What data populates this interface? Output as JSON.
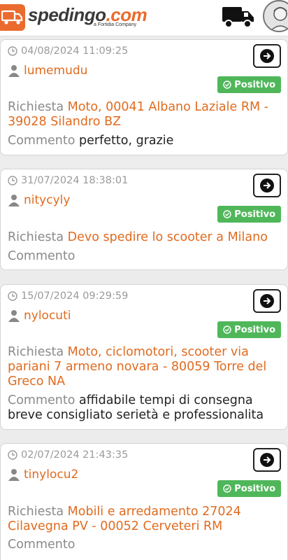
{
  "header": {
    "logo_name": "spedingo",
    "logo_dot": ".",
    "logo_tld": "com",
    "logo_sub": "a Fortidia Company",
    "truck_icon": "truck-icon",
    "avatar_icon": "avatar-icon"
  },
  "colors": {
    "accent": "#e06b1f",
    "positive": "#4fb75a"
  },
  "reviews": [
    {
      "date": "04/08/2024 11:09:25",
      "user": "lumemudu",
      "badge": "Positivo",
      "request_label": "Richiesta",
      "request": "Moto, 00041 Albano Laziale RM - 39028 Silandro BZ",
      "comment_label": "Commento",
      "comment": "perfetto, grazie"
    },
    {
      "date": "31/07/2024 18:38:01",
      "user": "nitycyly",
      "badge": "Positivo",
      "request_label": "Richiesta",
      "request": "Devo spedire lo scooter a Milano",
      "comment_label": "Commento",
      "comment": ""
    },
    {
      "date": "15/07/2024 09:29:59",
      "user": "nylocuti",
      "badge": "Positivo",
      "request_label": "Richiesta",
      "request": "Moto, ciclomotori, scooter via pariani 7 armeno novara - 80059 Torre del Greco NA",
      "comment_label": "Commento",
      "comment": "affidabile tempi di consegna breve consigliato serietà e professionalita"
    },
    {
      "date": "02/07/2024 21:43:35",
      "user": "tinylocu2",
      "badge": "Positivo",
      "request_label": "Richiesta",
      "request": "Mobili e arredamento 27024 Cilavegna PV - 00052 Cerveteri RM",
      "comment_label": "Commento",
      "comment": ""
    }
  ]
}
